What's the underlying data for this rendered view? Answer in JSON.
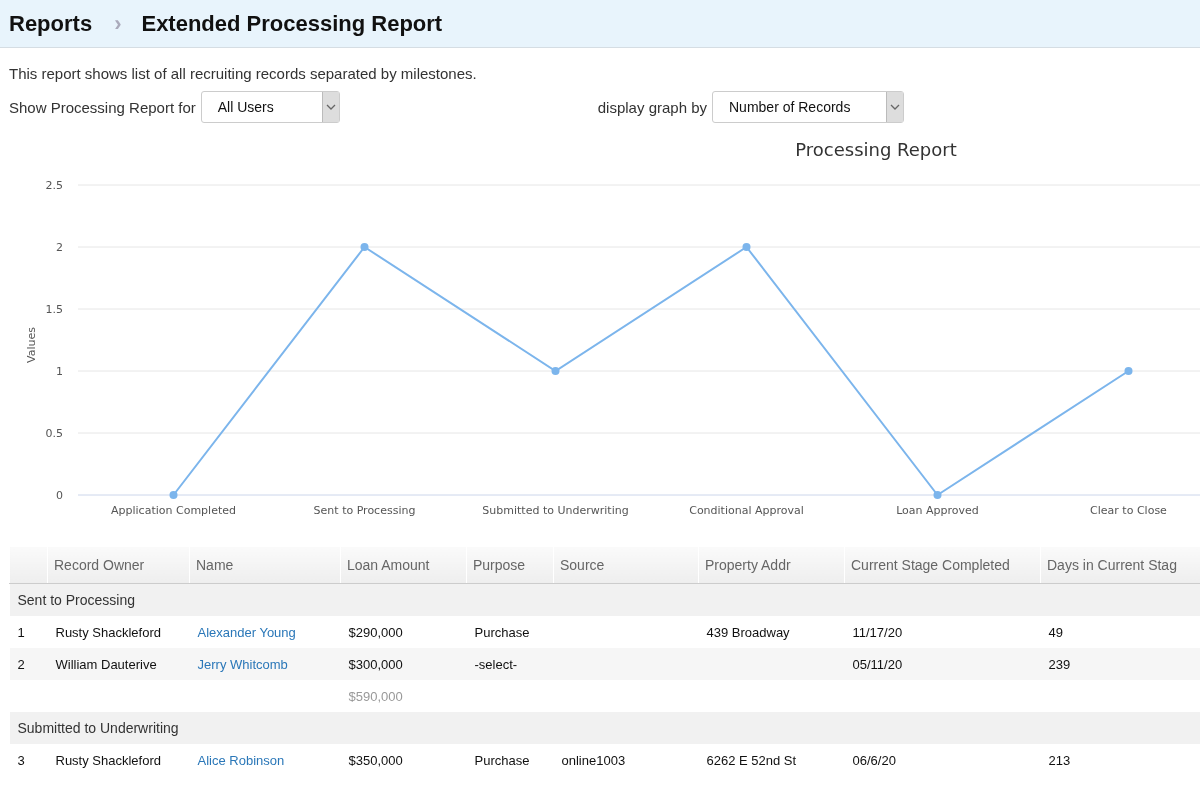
{
  "breadcrumb": {
    "parent": "Reports",
    "separator": "›",
    "title": "Extended Processing Report"
  },
  "description": "This report shows list of all recruiting records separated by milestones.",
  "filters": [
    {
      "label": "Show Processing Report for",
      "value": "All Users"
    },
    {
      "label": "display graph by",
      "value": "Number of Records"
    }
  ],
  "chart": {
    "chart_data": {
      "type": "line",
      "title": "Processing Report",
      "ylabel": "Values",
      "categories": [
        "Application Completed",
        "Sent to Processing",
        "Submitted to Underwriting",
        "Conditional Approval",
        "Loan Approved",
        "Clear to Close"
      ],
      "grid": true,
      "series": [
        {
          "color": "#7cb5ec",
          "marker": true,
          "values": [
            0,
            2,
            1,
            2,
            0,
            1
          ]
        }
      ],
      "ylim": [
        0,
        2.5
      ],
      "yticks": [
        0,
        0.5,
        1,
        1.5,
        2,
        2.5
      ]
    }
  },
  "table": {
    "columns": [
      "",
      "Record Owner",
      "Name",
      "Loan Amount",
      "Purpose",
      "Source",
      "Property Addr",
      "Current Stage Completed",
      "Days in Current Stag"
    ],
    "groups": [
      {
        "title": "Sent to Processing",
        "rows": [
          {
            "cells": [
              "1",
              "Rusty Shackleford",
              "Alexander Young",
              "$290,000",
              "Purchase",
              "",
              "439 Broadway",
              "11/17/20",
              "49"
            ]
          },
          {
            "cells": [
              "2",
              "William Dauterive",
              "Jerry Whitcomb",
              "$300,000",
              "-select-",
              "",
              "",
              "05/11/20",
              "239"
            ]
          }
        ],
        "total": "$590,000"
      },
      {
        "title": "Submitted to Underwriting",
        "rows": [
          {
            "cells": [
              "3",
              "Rusty Shackleford",
              "Alice Robinson",
              "$350,000",
              "Purchase",
              "online1003",
              "6262 E 52nd St",
              "06/6/20",
              "213"
            ]
          }
        ]
      }
    ]
  }
}
